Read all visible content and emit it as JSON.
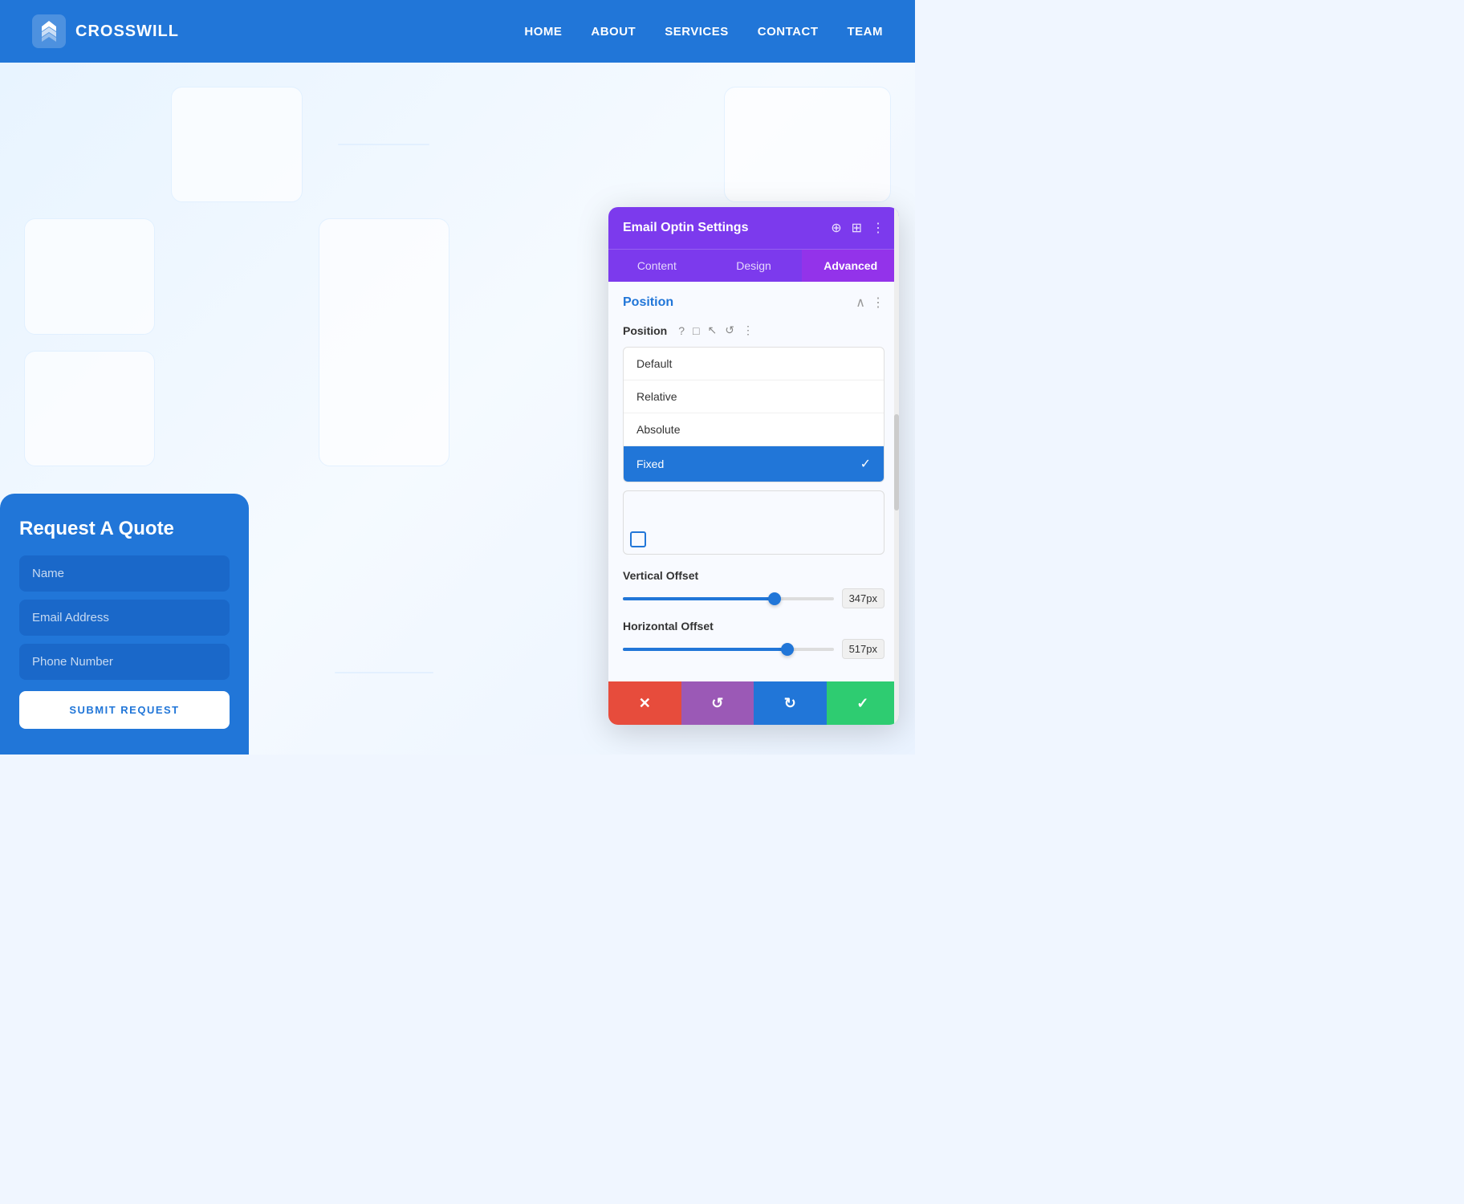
{
  "header": {
    "logo_text": "CROSSWILL",
    "nav": [
      {
        "label": "HOME",
        "active": false
      },
      {
        "label": "ABOUT",
        "active": false
      },
      {
        "label": "SERVICES",
        "active": false
      },
      {
        "label": "CONTACT",
        "active": true
      },
      {
        "label": "TEAM",
        "active": false
      }
    ]
  },
  "form": {
    "title": "Request A Quote",
    "name_placeholder": "Name",
    "email_placeholder": "Email Address",
    "phone_placeholder": "Phone Number",
    "submit_label": "SUBMIT REQUEST"
  },
  "settings": {
    "title": "Email Optin Settings",
    "tabs": [
      {
        "label": "Content",
        "active": false
      },
      {
        "label": "Design",
        "active": false
      },
      {
        "label": "Advanced",
        "active": true
      }
    ],
    "section_title": "Position",
    "position_label": "Position",
    "position_options": [
      {
        "label": "Default",
        "selected": false
      },
      {
        "label": "Relative",
        "selected": false
      },
      {
        "label": "Absolute",
        "selected": false
      },
      {
        "label": "Fixed",
        "selected": true
      }
    ],
    "vertical_offset_label": "Vertical Offset",
    "vertical_offset_value": "347px",
    "vertical_offset_percent": 72,
    "horizontal_offset_label": "Horizontal Offset",
    "horizontal_offset_value": "517px",
    "horizontal_offset_percent": 78,
    "action_buttons": {
      "cancel": "✕",
      "reset": "↺",
      "redo": "↻",
      "confirm": "✓"
    }
  }
}
